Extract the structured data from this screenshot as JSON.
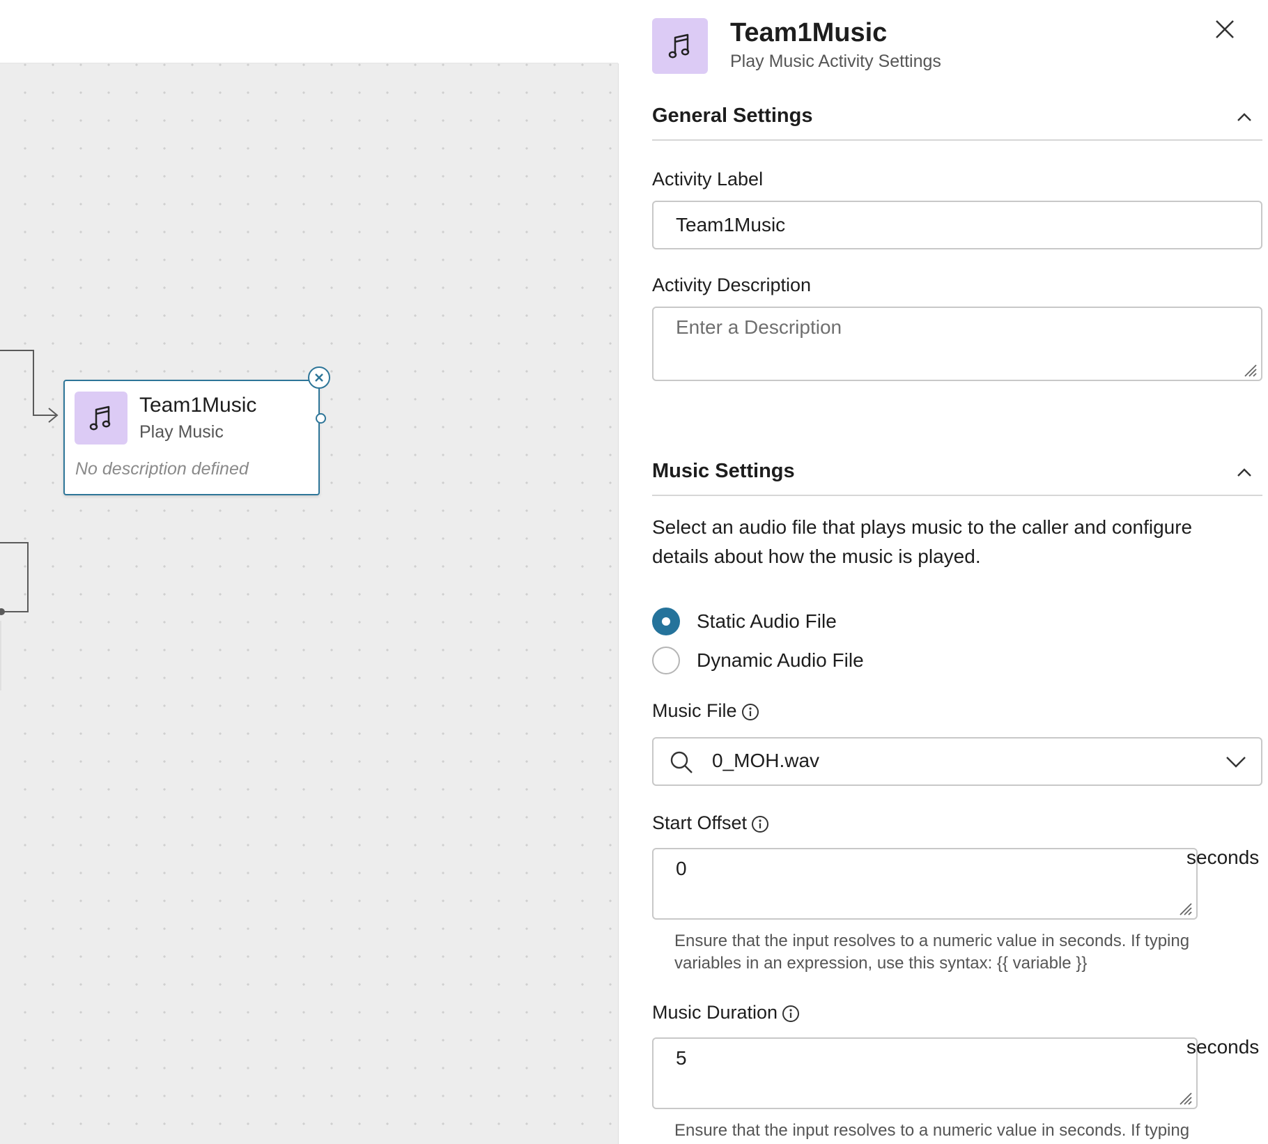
{
  "canvas": {
    "node": {
      "title": "Team1Music",
      "subtitle": "Play Music",
      "description": "No description defined"
    }
  },
  "panel": {
    "header": {
      "title": "Team1Music",
      "subtitle": "Play Music Activity Settings",
      "icon": "music-note-icon"
    },
    "general": {
      "title": "General Settings",
      "activity_label": "Activity Label",
      "activity_label_value": "Team1Music",
      "activity_description": "Activity Description",
      "activity_description_placeholder": "Enter a Description"
    },
    "music": {
      "title": "Music Settings",
      "description": "Select an audio file that plays music to the caller and configure details about how the music is played.",
      "radio_static": "Static Audio File",
      "radio_dynamic": "Dynamic Audio File",
      "selected_radio": "Static Audio File",
      "music_file_label": "Music File",
      "music_file_value": "0_MOH.wav",
      "start_offset_label": "Start Offset",
      "start_offset_value": "0",
      "duration_label": "Music Duration",
      "duration_value": "5",
      "unit": "seconds",
      "help_line1": "Ensure that the input resolves to a numeric value in seconds. If typing",
      "help_line2": "variables in an expression, use this syntax: {{ variable }}"
    }
  },
  "colors": {
    "accent": "#25739b",
    "node_border": "#2d7598",
    "icon_bg": "#dccbf5"
  }
}
